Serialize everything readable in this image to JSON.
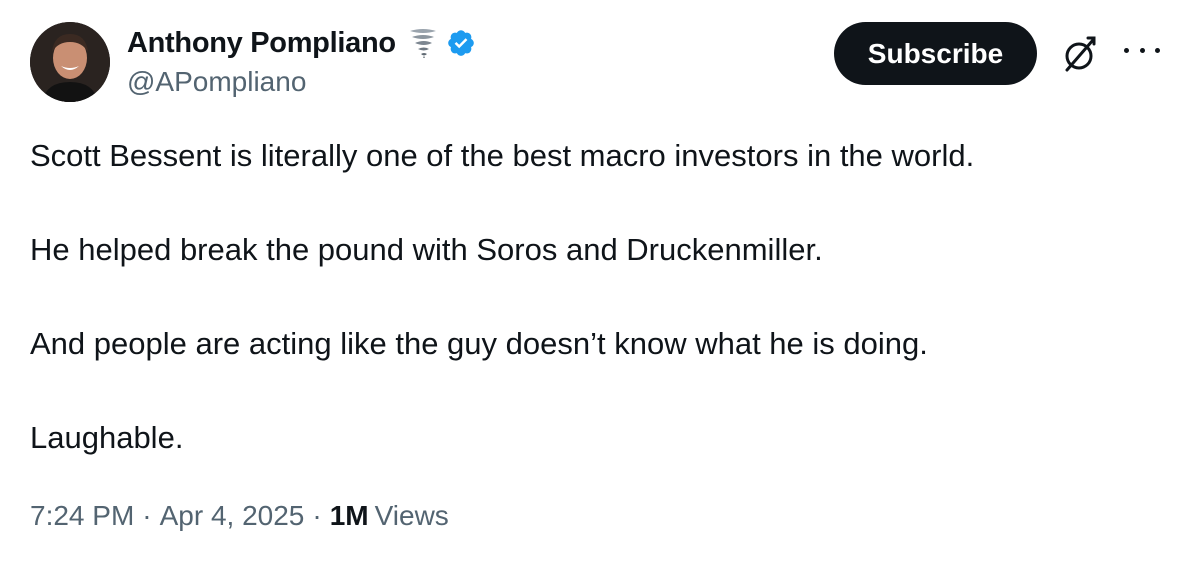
{
  "author": {
    "display_name": "Anthony Pompliano",
    "handle": "@APompliano",
    "emoji": "tornado-emoji",
    "verified_icon": "verified-badge-icon",
    "verified_color": "#1d9bf0",
    "avatar": "avatar-photo"
  },
  "actions": {
    "subscribe_label": "Subscribe",
    "grok_icon": "grok-icon",
    "more_icon": "more-options-icon"
  },
  "tweet": {
    "paragraphs": [
      "Scott Bessent is literally one of the best macro investors in the world.",
      "He helped break the pound with Soros and Druckenmiller.",
      "And people are acting like the guy doesn’t know what he is doing.",
      "Laughable."
    ]
  },
  "meta": {
    "time": "7:24 PM",
    "separator": "·",
    "date": "Apr 4, 2025",
    "views_count": "1M",
    "views_label": "Views"
  },
  "colors": {
    "text_primary": "#0f1419",
    "text_secondary": "#536471",
    "button_bg": "#0f1419",
    "button_text": "#ffffff"
  }
}
